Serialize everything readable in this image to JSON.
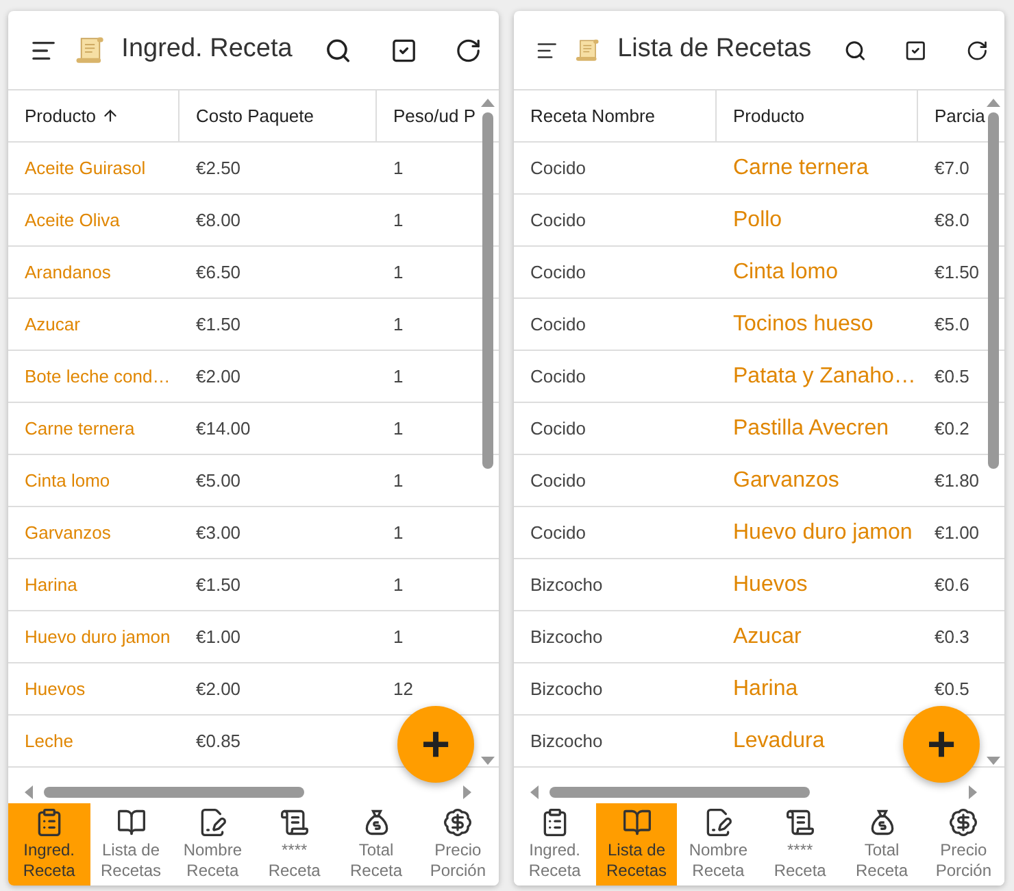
{
  "panels": [
    {
      "title": "Ingred. Receta",
      "columns": [
        {
          "label": "Producto",
          "kind": "product",
          "sort_ascending": true
        },
        {
          "label": "Costo Paquete",
          "kind": "plain"
        },
        {
          "label": "Peso/ud P",
          "kind": "plain"
        }
      ],
      "rows": [
        [
          "Aceite Guirasol",
          "€2.50",
          "1"
        ],
        [
          "Aceite Oliva",
          "€8.00",
          "1"
        ],
        [
          "Arandanos",
          "€6.50",
          "1"
        ],
        [
          "Azucar",
          "€1.50",
          "1"
        ],
        [
          "Bote leche cond…",
          "€2.00",
          "1"
        ],
        [
          "Carne ternera",
          "€14.00",
          "1"
        ],
        [
          "Cinta lomo",
          "€5.00",
          "1"
        ],
        [
          "Garvanzos",
          "€3.00",
          "1"
        ],
        [
          "Harina",
          "€1.50",
          "1"
        ],
        [
          "Huevo duro jamon",
          "€1.00",
          "1"
        ],
        [
          "Huevos",
          "€2.00",
          "12"
        ],
        [
          "Leche",
          "€0.85",
          ""
        ]
      ],
      "fab": "+",
      "nav": [
        {
          "label": [
            "Ingred.",
            "Receta"
          ],
          "selected": true
        },
        {
          "label": [
            "Lista de",
            "Recetas"
          ],
          "selected": false
        },
        {
          "label": [
            "Nombre",
            "Receta"
          ],
          "selected": false
        },
        {
          "label": [
            "****",
            "Receta"
          ],
          "selected": false
        },
        {
          "label": [
            "Total",
            "Receta"
          ],
          "selected": false
        },
        {
          "label": [
            "Precio",
            "Porción"
          ],
          "selected": false
        }
      ]
    },
    {
      "title": "Lista de Recetas",
      "columns": [
        {
          "label": "Receta Nombre",
          "kind": "plain"
        },
        {
          "label": "Producto",
          "kind": "product-large"
        },
        {
          "label": "Parcia",
          "kind": "plain"
        }
      ],
      "rows": [
        [
          "Cocido",
          "Carne ternera",
          "€7.0"
        ],
        [
          "Cocido",
          "Pollo",
          "€8.0"
        ],
        [
          "Cocido",
          "Cinta lomo",
          "€1.50"
        ],
        [
          "Cocido",
          "Tocinos hueso",
          "€5.0"
        ],
        [
          "Cocido",
          "Patata y Zanaho…",
          "€0.5"
        ],
        [
          "Cocido",
          "Pastilla Avecren",
          "€0.2"
        ],
        [
          "Cocido",
          "Garvanzos",
          "€1.80"
        ],
        [
          "Cocido",
          "Huevo duro jamon",
          "€1.00"
        ],
        [
          "Bizcocho",
          "Huevos",
          "€0.6"
        ],
        [
          "Bizcocho",
          "Azucar",
          "€0.3"
        ],
        [
          "Bizcocho",
          "Harina",
          "€0.5"
        ],
        [
          "Bizcocho",
          "Levadura",
          ""
        ]
      ],
      "fab": "+",
      "nav": [
        {
          "label": [
            "Ingred.",
            "Receta"
          ],
          "selected": false
        },
        {
          "label": [
            "Lista de",
            "Recetas"
          ],
          "selected": true
        },
        {
          "label": [
            "Nombre",
            "Receta"
          ],
          "selected": false
        },
        {
          "label": [
            "****",
            "Receta"
          ],
          "selected": false
        },
        {
          "label": [
            "Total",
            "Receta"
          ],
          "selected": false
        },
        {
          "label": [
            "Precio",
            "Porción"
          ],
          "selected": false
        }
      ]
    }
  ]
}
